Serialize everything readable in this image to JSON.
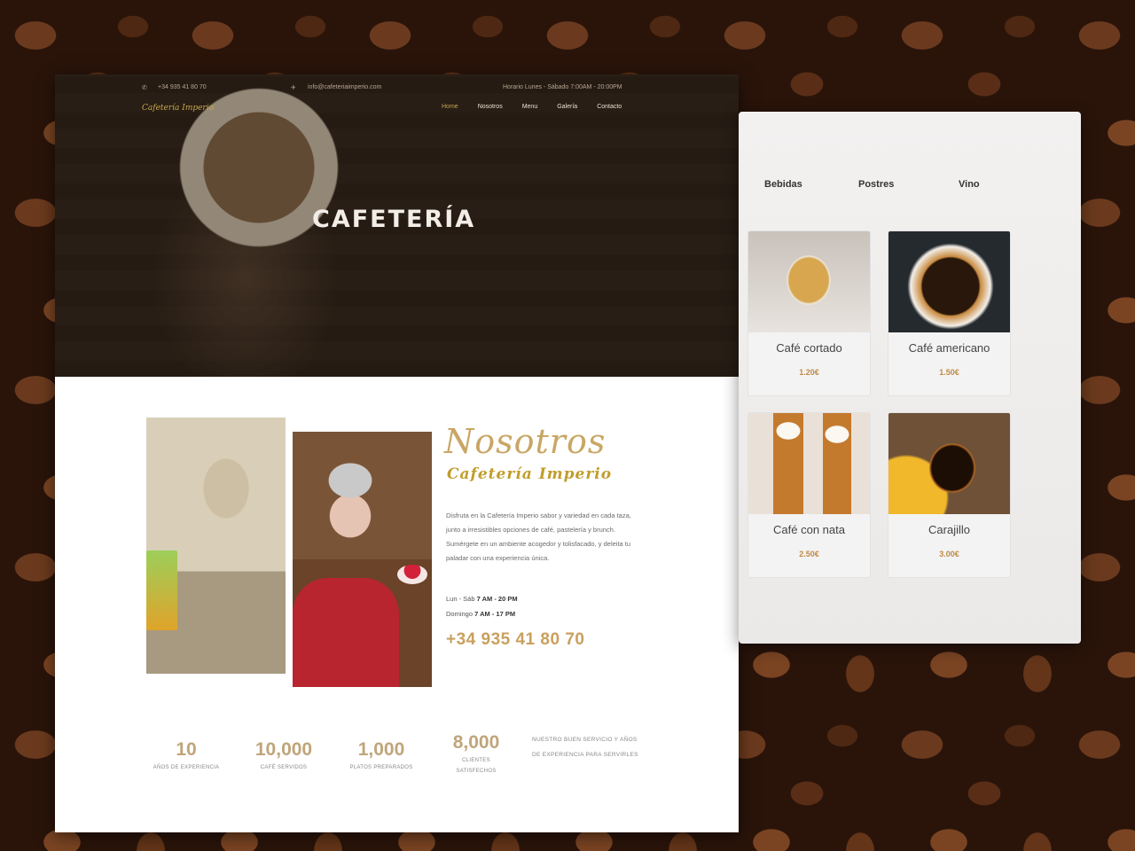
{
  "site": {
    "topbar": {
      "phone": "+34 935 41 80 70",
      "email": "info@cafeteriaimperio.com",
      "hours": "Horario Lunes - Sábado 7:00AM - 20:00PM"
    },
    "logo": "Cafetería Imperio",
    "nav": [
      "Home",
      "Nosotros",
      "Menu",
      "Galería",
      "Contacto"
    ],
    "hero_title": "CAFETERÍA",
    "about": {
      "title": "Nosotros",
      "subtitle": "Cafetería Imperio",
      "body": "Disfruta en la Cafetería Imperio sabor y variedad en cada taza, junto a irresistibles opciones de café, pastelería y brunch. Sumérgete en un ambiente acogedor y tolisfacado, y deleita tu paladar con una experiencia única.",
      "hours_weekday_label": "Lun - Sáb",
      "hours_weekday": "7 AM - 20 PM",
      "hours_sunday_label": "Domingo",
      "hours_sunday": "7 AM - 17 PM",
      "phone": "+34 935 41 80 70"
    },
    "stats": [
      {
        "num": "10",
        "label": "AÑOS DE EXPERIENCIA"
      },
      {
        "num": "10,000",
        "label": "CAFÉ SERVIDOS"
      },
      {
        "num": "1,000",
        "label": "PLATOS PREPARADOS"
      },
      {
        "num": "8,000",
        "label": "CLIENTES SATISFECHOS"
      }
    ],
    "stat_note": "NUESTRO BUEN SERVICIO Y AÑOS DE EXPERIENCIA PARA SERVIRLES"
  },
  "menu": {
    "tabs": [
      "Bebidas",
      "Postres",
      "Vino"
    ],
    "items": [
      {
        "name": "Café cortado",
        "price": "1.20€"
      },
      {
        "name": "Café americano",
        "price": "1.50€"
      },
      {
        "name": "Café con nata",
        "price": "2.50€"
      },
      {
        "name": "Carajillo",
        "price": "3.00€"
      }
    ]
  }
}
